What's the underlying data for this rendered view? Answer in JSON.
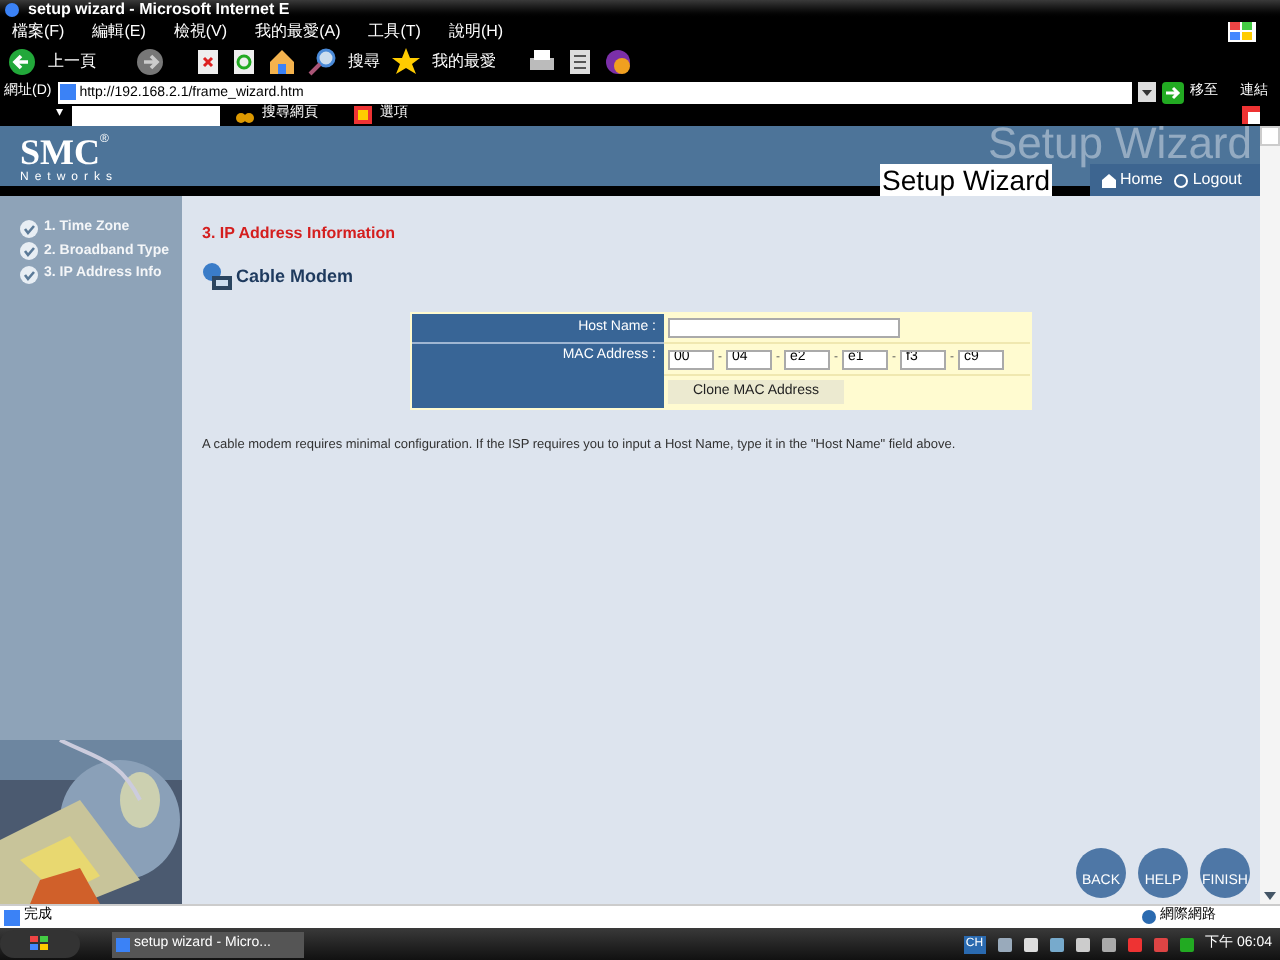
{
  "window": {
    "title": "setup wizard - Microsoft Internet E"
  },
  "menu": [
    "檔案(F)",
    "編輯(E)",
    "檢視(V)",
    "我的最愛(A)",
    "工具(T)",
    "說明(H)"
  ],
  "toolbar": {
    "back": "上一頁",
    "search": "搜尋",
    "favorites": "我的最愛"
  },
  "address": {
    "label": "網址(D)",
    "value": "http://192.168.2.1/frame_wizard.htm",
    "go": "移至",
    "links": "連結"
  },
  "links_bar": {
    "dropdown": "▾",
    "search_web": "搜尋網頁",
    "options": "選項"
  },
  "header": {
    "logo": "SMC",
    "logo_mark": "®",
    "logo_sub": "Networks",
    "banner": "Setup Wizard",
    "title": "Setup Wizard",
    "nav": [
      "Home",
      "Logout"
    ]
  },
  "steps": [
    {
      "label": "1. Time Zone",
      "done": true
    },
    {
      "label": "2. Broadband Type",
      "done": true
    },
    {
      "label": "3. IP Address Info",
      "done": true
    }
  ],
  "section_title": "3. IP Address Information",
  "subtitle": "Cable Modem",
  "form": {
    "host_label": "Host Name :",
    "mac_label": "MAC Address :",
    "mac": [
      "00",
      "04",
      "e2",
      "e1",
      "f3",
      "c9"
    ],
    "separator": "-",
    "clone": "Clone MAC Address"
  },
  "note": "A cable modem requires minimal configuration. If the ISP requires you to input a Host Name, type it in the \"Host Name\" field above.",
  "buttons": [
    "BACK",
    "HELP",
    "FINISH"
  ],
  "status_bar": {
    "text": "完成",
    "zone": "網際網路"
  },
  "taskbar": {
    "task": "setup wizard - Micro...",
    "lang": "CH",
    "clock": "下午 06:04"
  }
}
